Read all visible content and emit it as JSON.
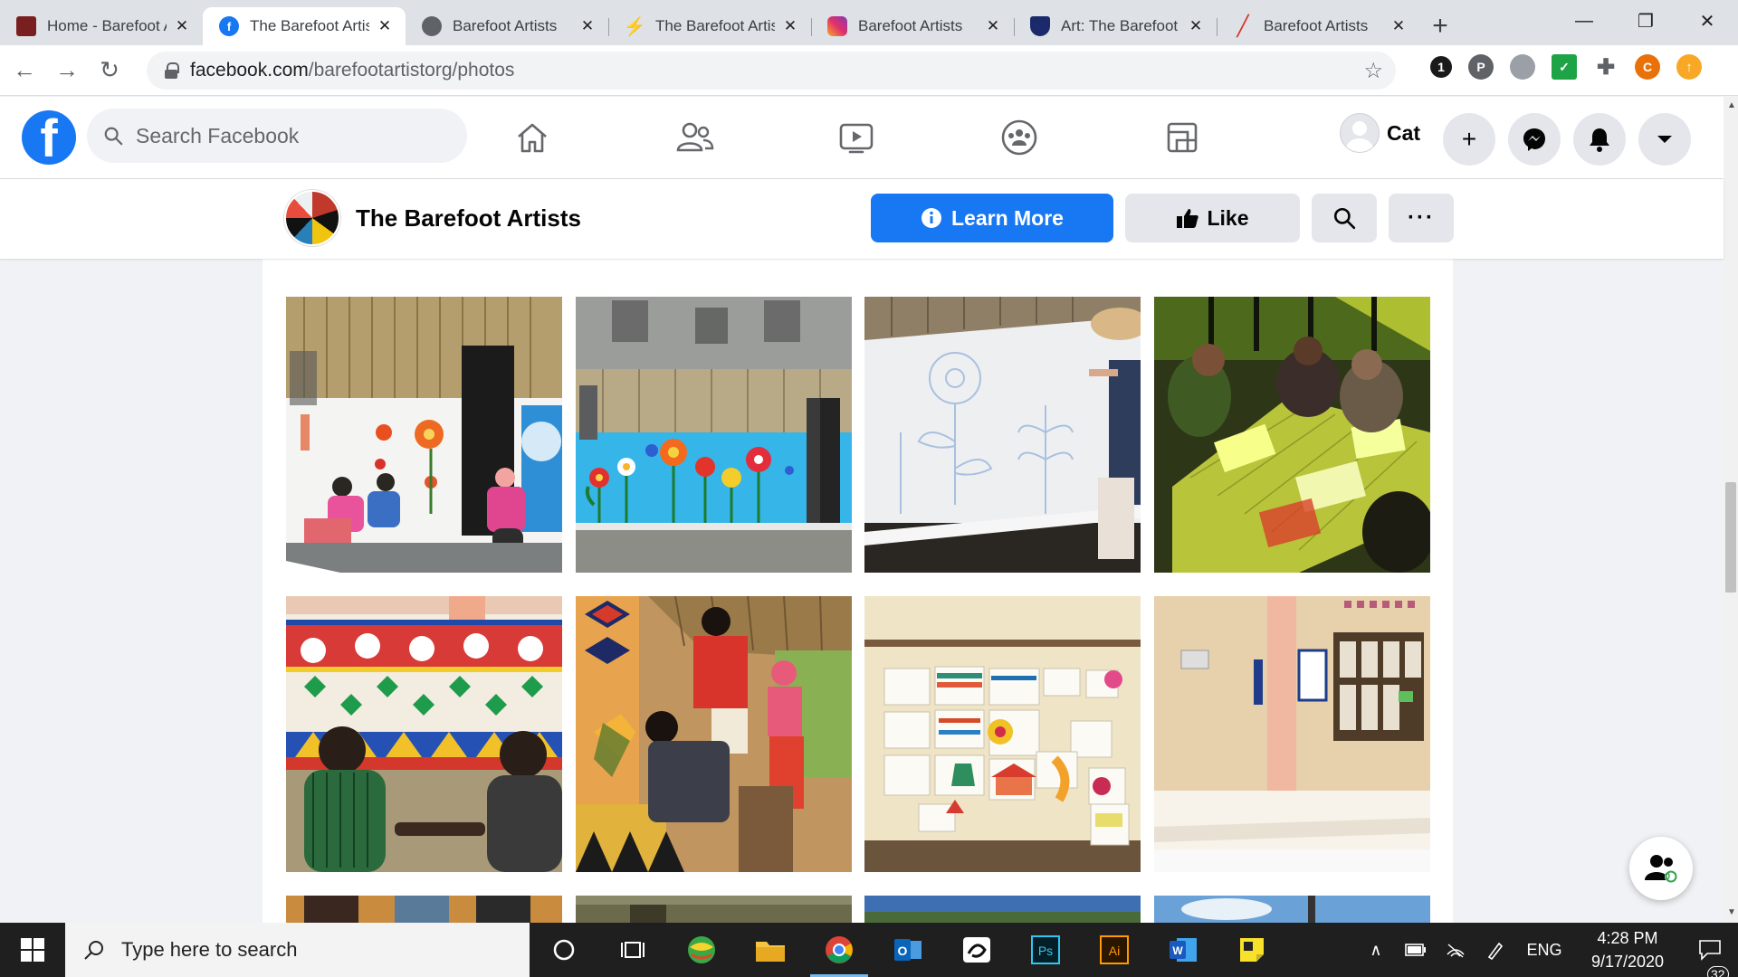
{
  "browser": {
    "tabs": [
      {
        "title": "Home - Barefoot Artists",
        "favicon": "barefoot-logo-icon",
        "color": "#b03a2e",
        "active": false
      },
      {
        "title": "The Barefoot Artists",
        "favicon": "facebook-icon",
        "color": "#1877f2",
        "active": true
      },
      {
        "title": "Barefoot Artists",
        "favicon": "globe-icon",
        "color": "#5f6368",
        "active": false
      },
      {
        "title": "The Barefoot Artists",
        "favicon": "bolt-icon",
        "color": "#202124",
        "active": false
      },
      {
        "title": "Barefoot Artists",
        "favicon": "instagram-icon",
        "color": "#c13584",
        "active": false
      },
      {
        "title": "Art: The Barefoot Artists",
        "favicon": "shield-icon",
        "color": "#1b2a6b",
        "active": false
      },
      {
        "title": "Barefoot Artists",
        "favicon": "slash-icon",
        "color": "#d93025",
        "active": false
      }
    ],
    "new_tab": "+",
    "url_domain": "facebook.com",
    "url_path": "/barefootartistorg/photos",
    "extensions": [
      "1",
      "P",
      "",
      "✓",
      "",
      "C",
      ""
    ]
  },
  "facebook": {
    "search_placeholder": "Search Facebook",
    "user_name": "Cat",
    "nav": [
      "home-icon",
      "friends-icon",
      "watch-icon",
      "groups-icon",
      "gaming-icon"
    ]
  },
  "page": {
    "name": "The Barefoot Artists",
    "learn_more": "Learn More",
    "like": "Like",
    "more": "···"
  },
  "photos": [
    {
      "name": "photo-woman-painting-mural-hut"
    },
    {
      "name": "photo-blue-wall-flower-mural"
    },
    {
      "name": "photo-sketching-outline-white-wall"
    },
    {
      "name": "photo-group-drawing-at-table"
    },
    {
      "name": "photo-boys-painted-wall-pattern"
    },
    {
      "name": "photo-painting-pillar-pattern"
    },
    {
      "name": "photo-drawings-on-board"
    },
    {
      "name": "photo-empty-veranda-column"
    }
  ],
  "float_badge": "0",
  "taskbar": {
    "search_placeholder": "Type here to search",
    "language": "ENG",
    "time": "4:28 PM",
    "date": "9/17/2020",
    "notifications": "32"
  },
  "colors": {
    "facebook_blue": "#1877f2",
    "chrome_tab_strip": "#dee1e6",
    "taskbar": "#1f1f1f"
  }
}
